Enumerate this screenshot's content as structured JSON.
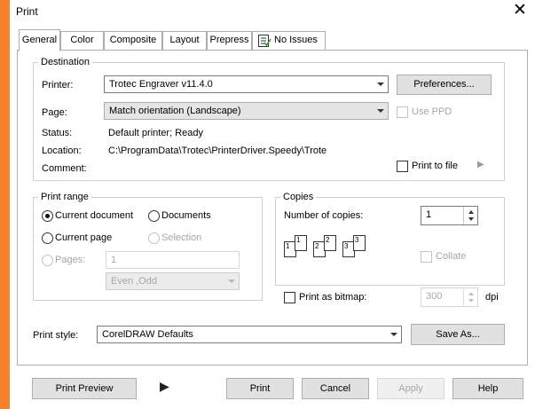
{
  "window": {
    "title": "Print",
    "close_glyph": "✕"
  },
  "tabs": [
    {
      "label": "General"
    },
    {
      "label": "Color"
    },
    {
      "label": "Composite"
    },
    {
      "label": "Layout"
    },
    {
      "label": "Prepress"
    },
    {
      "label": "No Issues"
    }
  ],
  "destination": {
    "group_label": "Destination",
    "printer_label": "Printer:",
    "printer_value": "Trotec Engraver v11.4.0",
    "preferences_label": "Preferences...",
    "page_label": "Page:",
    "page_value": "Match orientation (Landscape)",
    "use_ppd_label": "Use PPD",
    "status_label": "Status:",
    "status_value": "Default printer; Ready",
    "location_label": "Location:",
    "location_value": "C:\\ProgramData\\Trotec\\PrinterDriver.Speedy\\Trote",
    "comment_label": "Comment:",
    "print_to_file_label": "Print to file",
    "print_to_file_arrow": "▶"
  },
  "print_range": {
    "group_label": "Print range",
    "current_document": "Current document",
    "documents": "Documents",
    "current_page": "Current page",
    "selection": "Selection",
    "pages_label": "Pages:",
    "pages_value": "1",
    "even_odd_value": "Even ,Odd"
  },
  "copies": {
    "group_label": "Copies",
    "number_label": "Number of copies:",
    "number_value": "1",
    "collate_label": "Collate",
    "page_icons": [
      "1",
      "1",
      "2",
      "2",
      "3",
      "3"
    ]
  },
  "bitmap": {
    "label": "Print as bitmap:",
    "value": "300",
    "unit": "dpi"
  },
  "print_style": {
    "label": "Print style:",
    "value": "CorelDRAW Defaults",
    "save_as_label": "Save As..."
  },
  "bottom": {
    "print_preview": "Print Preview",
    "expand_glyph": "▶",
    "print": "Print",
    "cancel": "Cancel",
    "apply": "Apply",
    "help": "Help"
  },
  "colors": {
    "accent": "#f5822a",
    "dialog_bg": "#ffffff"
  }
}
